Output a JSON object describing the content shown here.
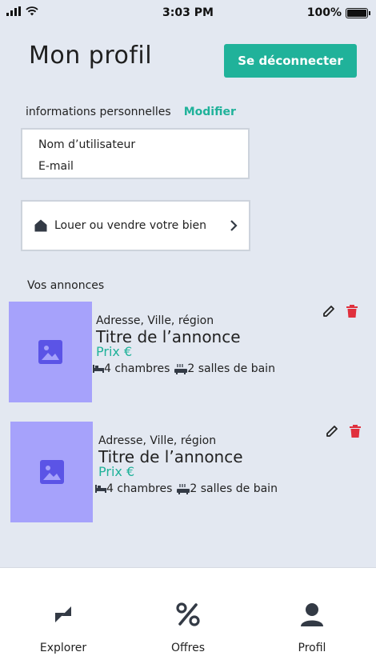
{
  "status_bar": {
    "time": "3:03 PM",
    "battery": "100%",
    "battery_level": 1.0
  },
  "header": {
    "title": "Mon profil",
    "logout_label": "Se déconnecter"
  },
  "personal_info": {
    "label": "informations personnelles",
    "edit_label": "Modifier",
    "username_label": "Nom d’utilisateur",
    "email_label": "E-mail"
  },
  "rent_sell": {
    "label": "Louer ou vendre votre bien",
    "icon": "house-icon"
  },
  "listings_section": {
    "title": "Vos annonces"
  },
  "listings": [
    {
      "address": "Adresse, Ville, région",
      "title": "Titre de l’annonce",
      "price": "Prix €",
      "bedrooms": "4 chambres",
      "bathrooms": "2 salles de bain"
    },
    {
      "address": "Adresse, Ville, région",
      "title": "Titre de l’annonce",
      "price": "Prix €",
      "bedrooms": "4 chambres",
      "bathrooms": "2 salles de bain"
    }
  ],
  "bottom_nav": {
    "items": [
      {
        "label": "Explorer",
        "icon": "compass-icon"
      },
      {
        "label": "Offres",
        "icon": "percent-icon"
      },
      {
        "label": "Profil",
        "icon": "user-icon"
      }
    ]
  },
  "colors": {
    "accent": "#20b29a",
    "delete": "#e0303d",
    "thumbnail": "#a6a2fb",
    "thumbnail_icon": "#5b54e6",
    "background": "#e3e8f1"
  }
}
